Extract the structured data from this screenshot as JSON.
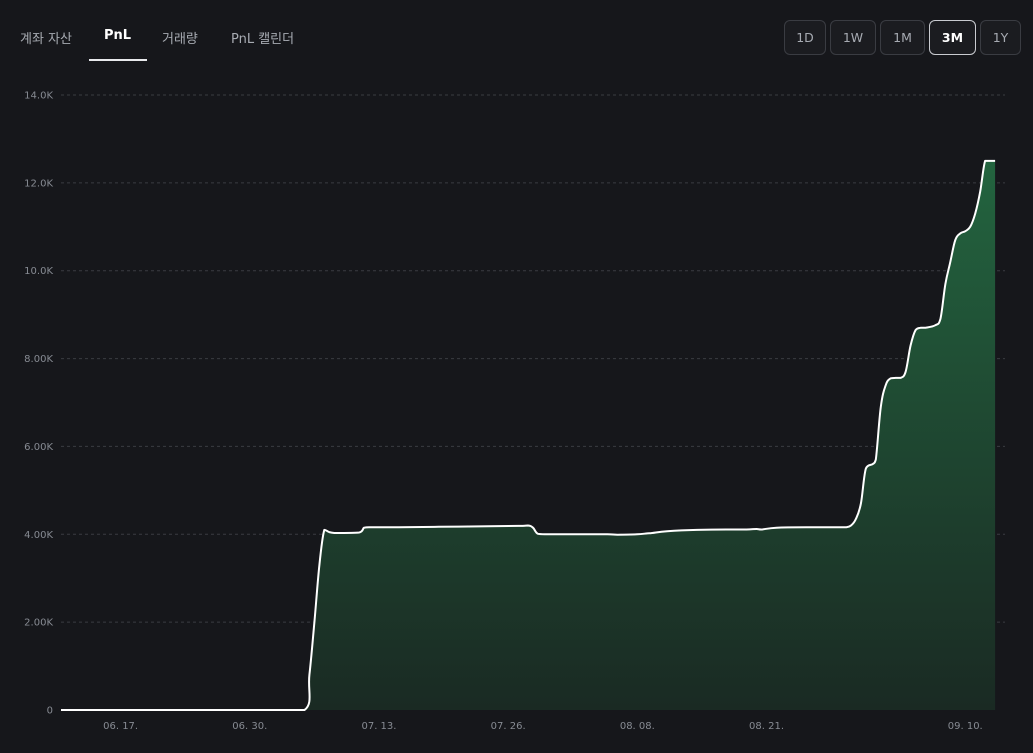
{
  "tabs": [
    {
      "label": "계좌 자산"
    },
    {
      "label": "PnL"
    },
    {
      "label": "거래량"
    },
    {
      "label": "PnL 캘린더"
    }
  ],
  "active_tab": "PnL",
  "ranges": [
    {
      "label": "1D"
    },
    {
      "label": "1W"
    },
    {
      "label": "1M"
    },
    {
      "label": "3M"
    },
    {
      "label": "1Y"
    }
  ],
  "active_range": "3M",
  "colors": {
    "background": "#16171b",
    "line": "#ffffff",
    "area_top": "#23643f",
    "area_bottom": "#1a2a23",
    "grid": "#3a3c42"
  },
  "chart_data": {
    "type": "area",
    "title": "",
    "xlabel": "",
    "ylabel": "",
    "ylim": [
      0,
      14000
    ],
    "yticks": [
      "0",
      "2.00K",
      "4.00K",
      "6.00K",
      "8.00K",
      "10.0K",
      "12.0K",
      "14.0K"
    ],
    "ytick_values": [
      0,
      2000,
      4000,
      6000,
      8000,
      10000,
      12000,
      14000
    ],
    "xticks": [
      "06. 17.",
      "06. 30.",
      "07. 13.",
      "07. 26.",
      "08. 08.",
      "08. 21.",
      "09. 10."
    ],
    "xtick_days": [
      6,
      19,
      32,
      45,
      58,
      71,
      91
    ],
    "xlim_days": [
      0,
      95
    ],
    "grid": "horizontal-dashed",
    "series": [
      {
        "x_days": [
          0,
          5,
          10,
          15,
          20,
          24.5,
          25,
          25.5,
          26,
          26.5,
          27,
          27.5,
          28,
          30,
          30.5,
          31,
          31.5,
          32,
          34,
          38,
          42,
          46,
          47,
          47.5,
          48,
          49,
          52,
          55,
          56,
          58,
          59,
          59.5,
          61,
          64,
          67,
          69,
          70,
          70.5,
          72,
          75,
          78,
          79,
          79.5,
          80,
          80.5,
          81,
          81.7,
          82,
          82.5,
          83,
          83.5,
          84,
          84.5,
          85,
          85.5,
          86,
          86.5,
          87,
          88,
          88.5,
          89,
          89.5,
          90,
          90.5,
          91,
          91.5,
          92,
          92.5,
          93,
          93.5,
          94
        ],
        "values": [
          0,
          0,
          0,
          0,
          0,
          0,
          800,
          2000,
          3300,
          4100,
          4050,
          4030,
          4030,
          4040,
          4150,
          4160,
          4160,
          4160,
          4160,
          4170,
          4180,
          4190,
          4200,
          4150,
          4010,
          4000,
          4000,
          4000,
          3990,
          4000,
          4020,
          4030,
          4070,
          4100,
          4110,
          4110,
          4120,
          4110,
          4150,
          4160,
          4160,
          4160,
          4200,
          4350,
          4700,
          5500,
          5600,
          5700,
          6900,
          7400,
          7550,
          7560,
          7560,
          7700,
          8300,
          8650,
          8700,
          8700,
          8760,
          8900,
          9700,
          10200,
          10700,
          10850,
          10900,
          11000,
          11300,
          11800,
          12500,
          12500,
          12500
        ]
      }
    ]
  }
}
